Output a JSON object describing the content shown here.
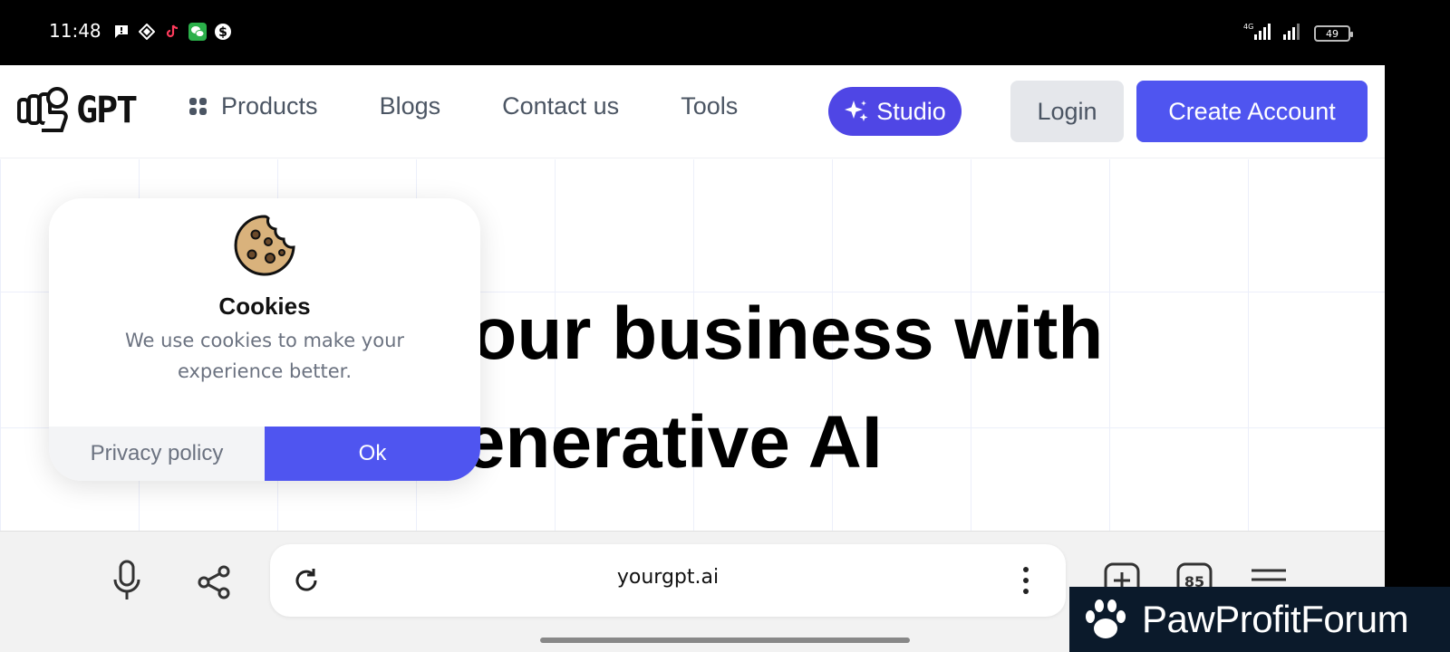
{
  "status_bar": {
    "time": "11:48",
    "network": "4G",
    "battery": "49"
  },
  "header": {
    "logo_text": "GPT",
    "nav": {
      "products": "Products",
      "blogs": "Blogs",
      "contact": "Contact us",
      "tools": "Tools"
    },
    "studio_label": "Studio",
    "login_label": "Login",
    "create_account_label": "Create Account"
  },
  "hero": {
    "line1": "r your business with",
    "line2": "Generative AI"
  },
  "cookie_banner": {
    "title": "Cookies",
    "text": "We use cookies to make your experience better.",
    "privacy_label": "Privacy policy",
    "ok_label": "Ok"
  },
  "browser": {
    "url": "yourgpt.ai",
    "tab_count": "85"
  },
  "watermark": {
    "text": "PawProfitForum"
  },
  "colors": {
    "accent": "#4f55f0",
    "studio": "#4f46e5"
  }
}
